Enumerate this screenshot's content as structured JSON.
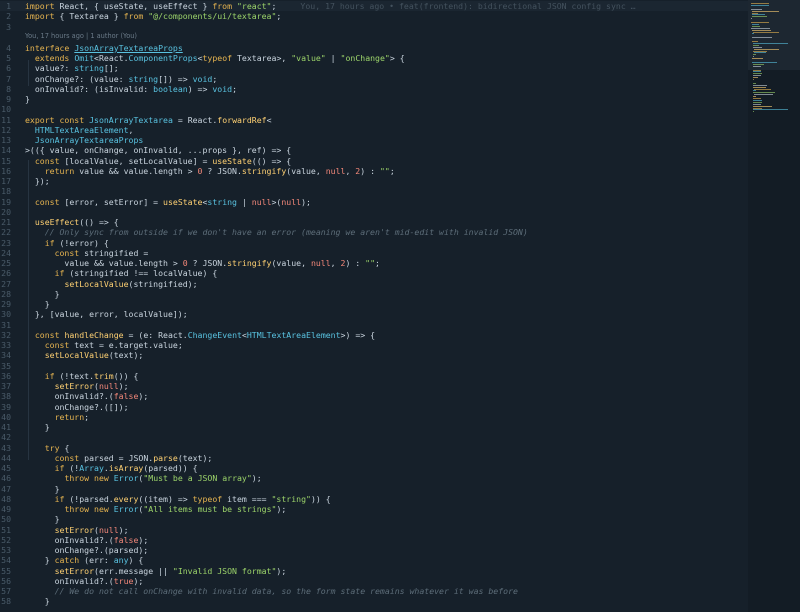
{
  "editor": {
    "codelens": "You, 17 hours ago | 1 author (You)",
    "blame": "You, 17 hours ago • feat(frontend): bidirectional JSON config sync …",
    "blame_line": 1,
    "current_line": 1,
    "lines": [
      {
        "n": "1",
        "t": [
          [
            "k",
            "import"
          ],
          [
            "p",
            " React, { useState, useEffect } "
          ],
          [
            "k",
            "from"
          ],
          [
            "s",
            " \"react\""
          ],
          [
            "p",
            ";"
          ]
        ]
      },
      {
        "n": "2",
        "t": [
          [
            "k",
            "import"
          ],
          [
            "p",
            " { Textarea } "
          ],
          [
            "k",
            "from"
          ],
          [
            "s",
            " \"@/components/ui/textarea\""
          ],
          [
            "p",
            ";"
          ]
        ]
      },
      {
        "n": "3",
        "t": []
      },
      {
        "n": "4",
        "t": [
          [
            "k",
            "interface"
          ],
          [
            "p",
            " "
          ],
          [
            "t",
            "JsonArrayTextareaProps"
          ]
        ]
      },
      {
        "n": "5",
        "t": [
          [
            "p",
            "  "
          ],
          [
            "k",
            "extends"
          ],
          [
            "p",
            " "
          ],
          [
            "t",
            "Omit"
          ],
          [
            "p",
            "<React."
          ],
          [
            "t",
            "ComponentProps"
          ],
          [
            "p",
            "<"
          ],
          [
            "k",
            "typeof"
          ],
          [
            "p",
            " Textarea>, "
          ],
          [
            "s",
            "\"value\""
          ],
          [
            "p",
            " | "
          ],
          [
            "s",
            "\"onChange\""
          ],
          [
            "p",
            "> {"
          ]
        ]
      },
      {
        "n": "6",
        "t": [
          [
            "p",
            "  value?: "
          ],
          [
            "t",
            "string"
          ],
          [
            "p",
            "[];"
          ]
        ]
      },
      {
        "n": "7",
        "t": [
          [
            "p",
            "  onChange?: (value: "
          ],
          [
            "t",
            "string"
          ],
          [
            "p",
            "[]) => "
          ],
          [
            "t",
            "void"
          ],
          [
            "p",
            ";"
          ]
        ]
      },
      {
        "n": "8",
        "t": [
          [
            "p",
            "  onInvalid?: (isInvalid: "
          ],
          [
            "t",
            "boolean"
          ],
          [
            "p",
            ") => "
          ],
          [
            "t",
            "void"
          ],
          [
            "p",
            ";"
          ]
        ]
      },
      {
        "n": "9",
        "t": [
          [
            "p",
            "}"
          ]
        ]
      },
      {
        "n": "10",
        "t": []
      },
      {
        "n": "11",
        "t": [
          [
            "k",
            "export const"
          ],
          [
            "p",
            " "
          ],
          [
            "t",
            "JsonArrayTextarea"
          ],
          [
            "p",
            " = React."
          ],
          [
            "f",
            "forwardRef"
          ],
          [
            "p",
            "<"
          ]
        ]
      },
      {
        "n": "12",
        "t": [
          [
            "p",
            "  "
          ],
          [
            "t",
            "HTMLTextAreaElement"
          ],
          [
            "p",
            ","
          ]
        ]
      },
      {
        "n": "13",
        "t": [
          [
            "p",
            "  "
          ],
          [
            "t",
            "JsonArrayTextareaProps"
          ]
        ]
      },
      {
        "n": "14",
        "t": [
          [
            "p",
            ">(({ value, onChange, onInvalid, ...props }, ref) => {"
          ]
        ]
      },
      {
        "n": "15",
        "t": [
          [
            "p",
            "  "
          ],
          [
            "k",
            "const"
          ],
          [
            "p",
            " [localValue, setLocalValue] = "
          ],
          [
            "f",
            "useState"
          ],
          [
            "p",
            "(() => {"
          ]
        ]
      },
      {
        "n": "16",
        "t": [
          [
            "p",
            "    "
          ],
          [
            "k",
            "return"
          ],
          [
            "p",
            " value && value.length > "
          ],
          [
            "n",
            "0"
          ],
          [
            "p",
            " ? JSON."
          ],
          [
            "f",
            "stringify"
          ],
          [
            "p",
            "(value, "
          ],
          [
            "n",
            "null"
          ],
          [
            "p",
            ", "
          ],
          [
            "n",
            "2"
          ],
          [
            "p",
            ") : "
          ],
          [
            "s",
            "\"\""
          ],
          [
            "p",
            ";"
          ]
        ]
      },
      {
        "n": "17",
        "t": [
          [
            "p",
            "  });"
          ]
        ]
      },
      {
        "n": "18",
        "t": []
      },
      {
        "n": "19",
        "t": [
          [
            "p",
            "  "
          ],
          [
            "k",
            "const"
          ],
          [
            "p",
            " [error, setError] = "
          ],
          [
            "f",
            "useState"
          ],
          [
            "p",
            "<"
          ],
          [
            "t",
            "string"
          ],
          [
            "p",
            " | "
          ],
          [
            "n",
            "null"
          ],
          [
            "p",
            ">("
          ],
          [
            "n",
            "null"
          ],
          [
            "p",
            ");"
          ]
        ]
      },
      {
        "n": "20",
        "t": []
      },
      {
        "n": "21",
        "t": [
          [
            "p",
            "  "
          ],
          [
            "f",
            "useEffect"
          ],
          [
            "p",
            "(() => {"
          ]
        ]
      },
      {
        "n": "22",
        "t": [
          [
            "c",
            "    // Only sync from outside if we don't have an error (meaning we aren't mid-edit with invalid JSON)"
          ]
        ]
      },
      {
        "n": "23",
        "t": [
          [
            "p",
            "    "
          ],
          [
            "k",
            "if"
          ],
          [
            "p",
            " (!error) {"
          ]
        ]
      },
      {
        "n": "24",
        "t": [
          [
            "p",
            "      "
          ],
          [
            "k",
            "const"
          ],
          [
            "p",
            " stringified ="
          ]
        ]
      },
      {
        "n": "25",
        "t": [
          [
            "p",
            "        value && value.length > "
          ],
          [
            "n",
            "0"
          ],
          [
            "p",
            " ? JSON."
          ],
          [
            "f",
            "stringify"
          ],
          [
            "p",
            "(value, "
          ],
          [
            "n",
            "null"
          ],
          [
            "p",
            ", "
          ],
          [
            "n",
            "2"
          ],
          [
            "p",
            ") : "
          ],
          [
            "s",
            "\"\""
          ],
          [
            "p",
            ";"
          ]
        ]
      },
      {
        "n": "26",
        "t": [
          [
            "p",
            "      "
          ],
          [
            "k",
            "if"
          ],
          [
            "p",
            " (stringified !== localValue) {"
          ]
        ]
      },
      {
        "n": "27",
        "t": [
          [
            "p",
            "        "
          ],
          [
            "f",
            "setLocalValue"
          ],
          [
            "p",
            "(stringified);"
          ]
        ]
      },
      {
        "n": "28",
        "t": [
          [
            "p",
            "      }"
          ]
        ]
      },
      {
        "n": "29",
        "t": [
          [
            "p",
            "    }"
          ]
        ]
      },
      {
        "n": "30",
        "t": [
          [
            "p",
            "  }, [value, error, localValue]);"
          ]
        ]
      },
      {
        "n": "31",
        "t": []
      },
      {
        "n": "32",
        "t": [
          [
            "p",
            "  "
          ],
          [
            "k",
            "const"
          ],
          [
            "p",
            " "
          ],
          [
            "f",
            "handleChange"
          ],
          [
            "p",
            " = (e: React."
          ],
          [
            "t",
            "ChangeEvent"
          ],
          [
            "p",
            "<"
          ],
          [
            "t",
            "HTMLTextAreaElement"
          ],
          [
            "p",
            ">) => {"
          ]
        ]
      },
      {
        "n": "33",
        "t": [
          [
            "p",
            "    "
          ],
          [
            "k",
            "const"
          ],
          [
            "p",
            " text = e.target.value;"
          ]
        ]
      },
      {
        "n": "34",
        "t": [
          [
            "p",
            "    "
          ],
          [
            "f",
            "setLocalValue"
          ],
          [
            "p",
            "(text);"
          ]
        ]
      },
      {
        "n": "35",
        "t": []
      },
      {
        "n": "36",
        "t": [
          [
            "p",
            "    "
          ],
          [
            "k",
            "if"
          ],
          [
            "p",
            " (!text."
          ],
          [
            "f",
            "trim"
          ],
          [
            "p",
            "()) {"
          ]
        ]
      },
      {
        "n": "37",
        "t": [
          [
            "p",
            "      "
          ],
          [
            "f",
            "setError"
          ],
          [
            "p",
            "("
          ],
          [
            "n",
            "null"
          ],
          [
            "p",
            ");"
          ]
        ]
      },
      {
        "n": "38",
        "t": [
          [
            "p",
            "      onInvalid?.("
          ],
          [
            "n",
            "false"
          ],
          [
            "p",
            ");"
          ]
        ]
      },
      {
        "n": "39",
        "t": [
          [
            "p",
            "      onChange?.([]);"
          ]
        ]
      },
      {
        "n": "40",
        "t": [
          [
            "p",
            "      "
          ],
          [
            "k",
            "return"
          ],
          [
            "p",
            ";"
          ]
        ]
      },
      {
        "n": "41",
        "t": [
          [
            "p",
            "    }"
          ]
        ]
      },
      {
        "n": "42",
        "t": []
      },
      {
        "n": "43",
        "t": [
          [
            "p",
            "    "
          ],
          [
            "k",
            "try"
          ],
          [
            "p",
            " {"
          ]
        ]
      },
      {
        "n": "44",
        "t": [
          [
            "p",
            "      "
          ],
          [
            "k",
            "const"
          ],
          [
            "p",
            " parsed = JSON."
          ],
          [
            "f",
            "parse"
          ],
          [
            "p",
            "(text);"
          ]
        ]
      },
      {
        "n": "45",
        "t": [
          [
            "p",
            "      "
          ],
          [
            "k",
            "if"
          ],
          [
            "p",
            " (!"
          ],
          [
            "t",
            "Array"
          ],
          [
            "p",
            "."
          ],
          [
            "f",
            "isArray"
          ],
          [
            "p",
            "(parsed)) {"
          ]
        ]
      },
      {
        "n": "46",
        "t": [
          [
            "p",
            "        "
          ],
          [
            "k",
            "throw new"
          ],
          [
            "p",
            " "
          ],
          [
            "t",
            "Error"
          ],
          [
            "p",
            "("
          ],
          [
            "s",
            "\"Must be a JSON array\""
          ],
          [
            "p",
            ");"
          ]
        ]
      },
      {
        "n": "47",
        "t": [
          [
            "p",
            "      }"
          ]
        ]
      },
      {
        "n": "48",
        "t": [
          [
            "p",
            "      "
          ],
          [
            "k",
            "if"
          ],
          [
            "p",
            " (!parsed."
          ],
          [
            "f",
            "every"
          ],
          [
            "p",
            "((item) => "
          ],
          [
            "k",
            "typeof"
          ],
          [
            "p",
            " item === "
          ],
          [
            "s",
            "\"string\""
          ],
          [
            "p",
            ")) {"
          ]
        ]
      },
      {
        "n": "49",
        "t": [
          [
            "p",
            "        "
          ],
          [
            "k",
            "throw new"
          ],
          [
            "p",
            " "
          ],
          [
            "t",
            "Error"
          ],
          [
            "p",
            "("
          ],
          [
            "s",
            "\"All items must be strings\""
          ],
          [
            "p",
            ");"
          ]
        ]
      },
      {
        "n": "50",
        "t": [
          [
            "p",
            "      }"
          ]
        ]
      },
      {
        "n": "51",
        "t": [
          [
            "p",
            "      "
          ],
          [
            "f",
            "setError"
          ],
          [
            "p",
            "("
          ],
          [
            "n",
            "null"
          ],
          [
            "p",
            ");"
          ]
        ]
      },
      {
        "n": "52",
        "t": [
          [
            "p",
            "      onInvalid?.("
          ],
          [
            "n",
            "false"
          ],
          [
            "p",
            ");"
          ]
        ]
      },
      {
        "n": "53",
        "t": [
          [
            "p",
            "      onChange?.(parsed);"
          ]
        ]
      },
      {
        "n": "54",
        "t": [
          [
            "p",
            "    } "
          ],
          [
            "k",
            "catch"
          ],
          [
            "p",
            " (err: "
          ],
          [
            "t",
            "any"
          ],
          [
            "p",
            ") {"
          ]
        ]
      },
      {
        "n": "55",
        "t": [
          [
            "p",
            "      "
          ],
          [
            "f",
            "setError"
          ],
          [
            "p",
            "(err.message || "
          ],
          [
            "s",
            "\"Invalid JSON format\""
          ],
          [
            "p",
            ");"
          ]
        ]
      },
      {
        "n": "56",
        "t": [
          [
            "p",
            "      onInvalid?.("
          ],
          [
            "n",
            "true"
          ],
          [
            "p",
            ");"
          ]
        ]
      },
      {
        "n": "57",
        "t": [
          [
            "c",
            "      // We do not call onChange with invalid data, so the form state remains whatever it was before"
          ]
        ]
      },
      {
        "n": "58",
        "t": [
          [
            "p",
            "    }"
          ]
        ]
      }
    ]
  }
}
